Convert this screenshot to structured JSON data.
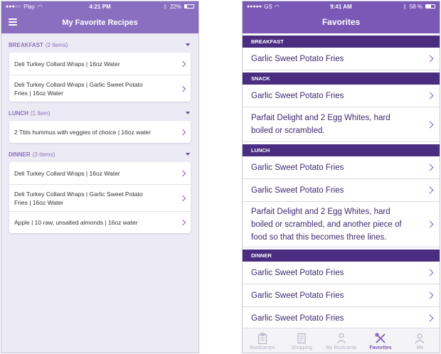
{
  "left": {
    "status": {
      "carrier": "Play",
      "time": "4:21 PM",
      "battery": "22%"
    },
    "title": "My Favorite Recipes",
    "sections": [
      {
        "name": "BREAKFAST",
        "count": "(2 Items)",
        "items": [
          [
            "Deli Turkey Collard Wraps | 16oz Water"
          ],
          [
            "Deli Turkey Collard Wraps | Garlic Sweet Potato",
            "Fries | 16oz Water"
          ]
        ]
      },
      {
        "name": "LUNCH",
        "count": "(1 Item)",
        "items": [
          [
            "2 Tbls hummus with veggies of choice | 16oz water"
          ]
        ]
      },
      {
        "name": "DINNER",
        "count": "(3 Items)",
        "items": [
          [
            "Deli Turkey Collard Wraps | 16oz Water"
          ],
          [
            "Deli Turkey Collard Wraps | Garlic Sweet Potato",
            "Fries | 16oz Water"
          ],
          [
            "Apple |  10 raw, unsalted almonds  | 16oz water"
          ]
        ]
      }
    ]
  },
  "right": {
    "status": {
      "carrier": "GS",
      "time": "9:41 AM",
      "battery": "58 %"
    },
    "title": "Favorites",
    "sections": [
      {
        "name": "BREAKFAST",
        "items": [
          [
            "Garlic Sweet Potato Fries"
          ]
        ]
      },
      {
        "name": "SNACK",
        "items": [
          [
            "Garlic Sweet Potato Fries"
          ],
          [
            "Parfait Delight and 2 Egg Whites, hard",
            "boiled or scrambled."
          ]
        ]
      },
      {
        "name": "LUNCH",
        "items": [
          [
            "Garlic Sweet Potato Fries"
          ],
          [
            "Garlic Sweet Potato Fries"
          ],
          [
            "Parfait Delight and 2 Egg Whites, hard",
            "boiled or scrambled, and another piece of",
            "food so that this becomes three lines."
          ]
        ]
      },
      {
        "name": "DINNER",
        "items": [
          [
            "Garlic Sweet Potato Fries"
          ],
          [
            "Garlic Sweet Potato Fries"
          ],
          [
            "Garlic Sweet Potato Fries"
          ]
        ]
      }
    ],
    "tabs": [
      {
        "label": "Bootcamps",
        "icon": "clipboard-icon",
        "active": false
      },
      {
        "label": "Shopping",
        "icon": "list-icon",
        "active": false
      },
      {
        "label": "My Bootcamp",
        "icon": "person-icon",
        "active": false
      },
      {
        "label": "Favorites",
        "icon": "utensils-icon",
        "active": true
      },
      {
        "label": "Me",
        "icon": "user-icon",
        "active": false
      }
    ]
  },
  "colors": {
    "accent": "#8a6fc1",
    "header_right": "#7a58b6",
    "section_dark": "#4a2d80",
    "chevron": "#8a55c9"
  }
}
